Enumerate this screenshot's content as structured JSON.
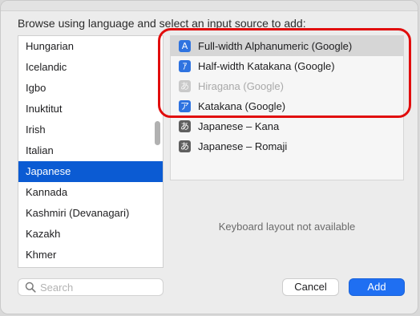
{
  "dialog": {
    "instruction": "Browse using language and select an input source to add:"
  },
  "languages": {
    "items": [
      {
        "label": "Hungarian"
      },
      {
        "label": "Icelandic"
      },
      {
        "label": "Igbo"
      },
      {
        "label": "Inuktitut"
      },
      {
        "label": "Irish"
      },
      {
        "label": "Italian"
      },
      {
        "label": "Japanese",
        "selected": true
      },
      {
        "label": "Kannada"
      },
      {
        "label": "Kashmiri (Devanagari)"
      },
      {
        "label": "Kazakh"
      },
      {
        "label": "Khmer"
      }
    ]
  },
  "sources": {
    "items": [
      {
        "label": "Full-width Alphanumeric (Google)",
        "icon_glyph": "A",
        "icon": "full-width-alphanumeric-icon",
        "highlighted": true
      },
      {
        "label": "Half-width Katakana (Google)",
        "icon_glyph": "ｱ",
        "icon": "half-width-katakana-icon"
      },
      {
        "label": "Hiragana (Google)",
        "icon_glyph": "あ",
        "icon": "hiragana-icon",
        "disabled": true
      },
      {
        "label": "Katakana (Google)",
        "icon_glyph": "ア",
        "icon": "katakana-icon"
      },
      {
        "label": "Japanese – Kana",
        "icon_glyph": "あ",
        "icon": "japanese-kana-icon"
      },
      {
        "label": "Japanese – Romaji",
        "icon_glyph": "あ",
        "icon": "japanese-romaji-icon"
      }
    ],
    "preview_text": "Keyboard layout not available"
  },
  "search": {
    "placeholder": "Search",
    "value": ""
  },
  "buttons": {
    "cancel_label": "Cancel",
    "add_label": "Add"
  },
  "colors": {
    "accent": "#0b5bd3",
    "add_button": "#1f6ff2",
    "highlight_ring": "#e10d0d"
  }
}
